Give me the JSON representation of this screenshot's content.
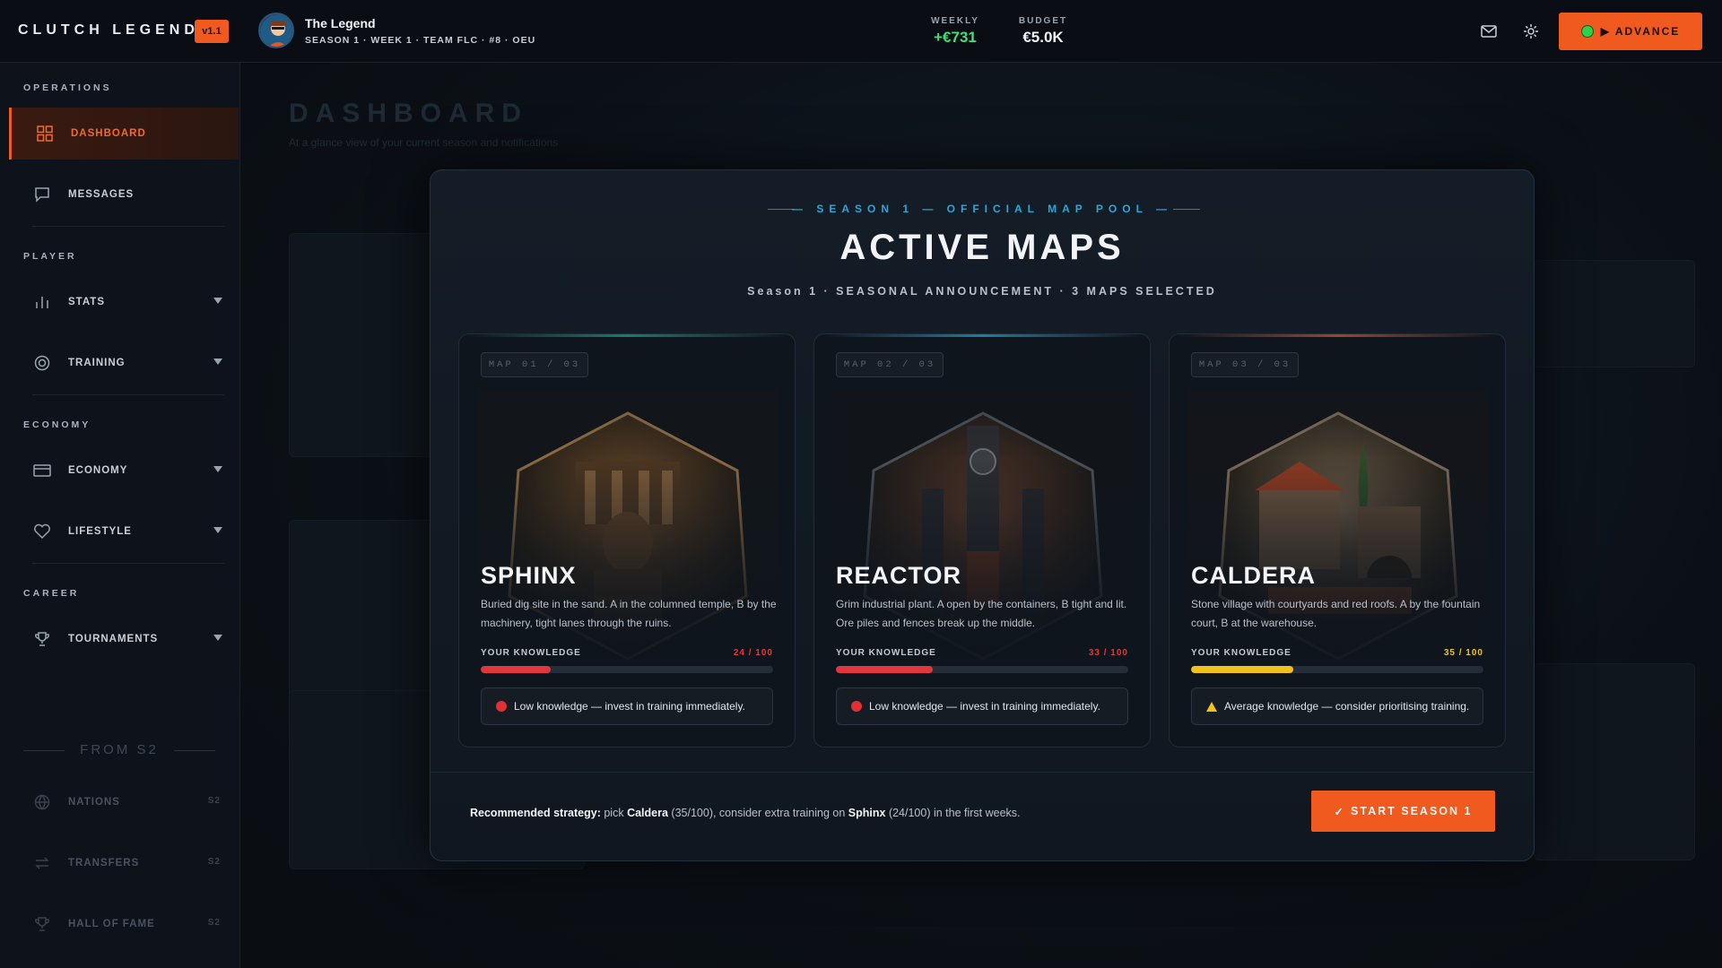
{
  "app": {
    "brand": "CLUTCH LEGEND",
    "version": "v1.1"
  },
  "player": {
    "name": "The Legend",
    "meta": "SEASON 1 · WEEK 1 · TEAM FLC · #8 · OEU"
  },
  "stats": {
    "weekly_label": "WEEKLY",
    "weekly_value": "+€731",
    "budget_label": "BUDGET",
    "budget_value": "€5.0K"
  },
  "toolbar": {
    "advance_label": "▶ ADVANCE"
  },
  "sidebar": {
    "sections": {
      "operations": "OPERATIONS",
      "player": "PLAYER",
      "economy": "ECONOMY",
      "career": "CAREER"
    },
    "items": {
      "dashboard": "DASHBOARD",
      "messages": "MESSAGES",
      "stats": "STATS",
      "training": "TRAINING",
      "economy": "ECONOMY",
      "lifestyle": "LIFESTYLE",
      "tournaments": "TOURNAMENTS",
      "nations": "NATIONS",
      "transfers": "TRANSFERS",
      "hall_of_fame": "HALL OF FAME"
    },
    "from_s2": "FROM S2",
    "s2_badge": "S2"
  },
  "background": {
    "title": "DASHBOARD",
    "subtitle": "At a glance view of your current season and notifications"
  },
  "modal": {
    "kicker": "— SEASON 1 — OFFICIAL MAP POOL —",
    "title": "ACTIVE MAPS",
    "subtitle": "Season 1 · SEASONAL ANNOUNCEMENT · 3 MAPS SELECTED",
    "knowledge_label": "YOUR KNOWLEDGE",
    "maps": [
      {
        "tag": "MAP 01 / 03",
        "name": "SPHINX",
        "description": "Buried dig site in the sand. A in the columned temple, B by the machinery, tight lanes through the ruins.",
        "knowledge_text": "24 / 100",
        "knowledge": 24,
        "color": "#e0373d",
        "accent": "#1fa88a",
        "advice": "Low knowledge — invest in training immediately.",
        "advice_icon": "red-dot-icon"
      },
      {
        "tag": "MAP 02 / 03",
        "name": "REACTOR",
        "description": "Grim industrial plant. A open by the containers, B tight and lit. Ore piles and fences break up the middle.",
        "knowledge_text": "33 / 100",
        "knowledge": 33,
        "color": "#e0373d",
        "accent": "#2aa7d8",
        "advice": "Low knowledge — invest in training immediately.",
        "advice_icon": "red-dot-icon"
      },
      {
        "tag": "MAP 03 / 03",
        "name": "CALDERA",
        "description": "Stone village with courtyards and red roofs. A by the fountain court, B at the warehouse.",
        "knowledge_text": "35 / 100",
        "knowledge": 35,
        "color": "#f2c21a",
        "accent": "#e0582a",
        "advice": "Average knowledge — consider prioritising training.",
        "advice_icon": "warning-icon"
      }
    ],
    "strategy": {
      "label": "Recommended strategy:",
      "t1": "pick",
      "m1": "Caldera",
      "t2": "(35/100), consider extra training on",
      "m2": "Sphinx",
      "t3": "(24/100) in the first weeks."
    },
    "start_label": "START SEASON 1"
  }
}
